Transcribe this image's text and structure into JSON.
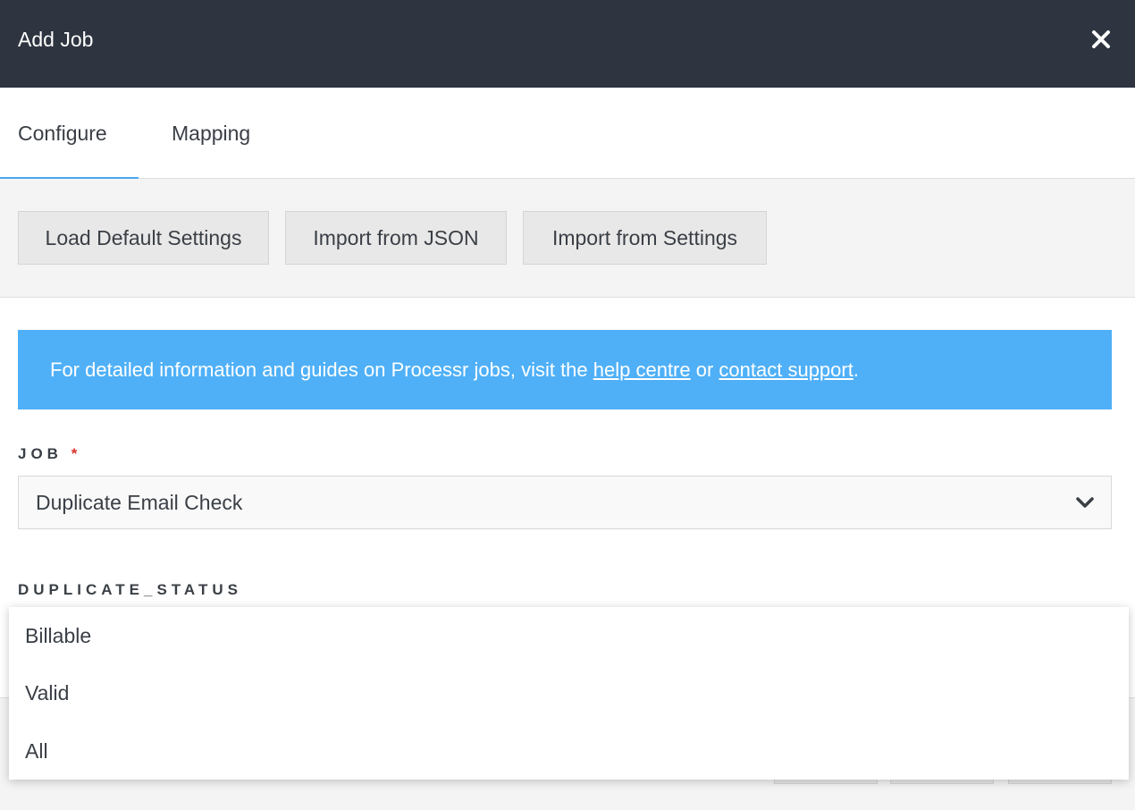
{
  "header": {
    "title": "Add Job",
    "close_icon": "close-icon"
  },
  "tabs": [
    {
      "label": "Configure",
      "active": true
    },
    {
      "label": "Mapping",
      "active": false
    }
  ],
  "toolbar": {
    "load_default": "Load Default Settings",
    "import_json": "Import from JSON",
    "import_settings": "Import from Settings"
  },
  "info": {
    "text_before": "For detailed information and guides on Processr jobs, visit the ",
    "help_link": "help centre",
    "text_middle": " or ",
    "support_link": "contact support",
    "text_after": "."
  },
  "job_field": {
    "label": "JOB",
    "required_mark": "*",
    "value": "Duplicate Email Check",
    "icon": "chevron-down-icon"
  },
  "duplicate_status": {
    "label": "DUPLICATE_STATUS",
    "options": [
      "Billable",
      "Valid",
      "All"
    ]
  },
  "colors": {
    "header_bg": "#2e3440",
    "accent": "#4aa8f0",
    "info_bg": "#4fb0f7",
    "required": "#d9342b"
  }
}
